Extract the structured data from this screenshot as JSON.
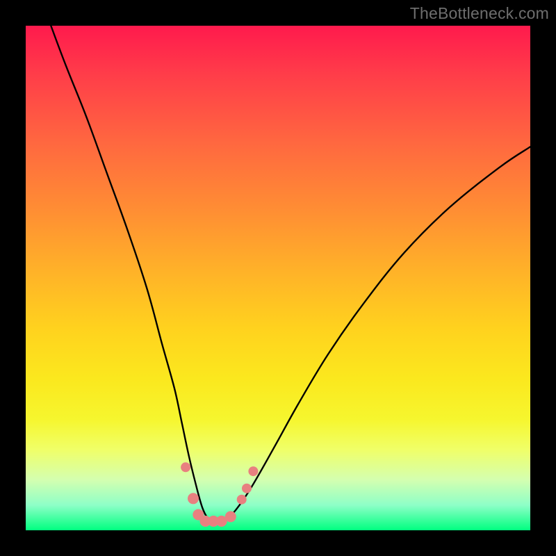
{
  "watermark": "TheBottleneck.com",
  "chart_data": {
    "type": "line",
    "title": "",
    "xlabel": "",
    "ylabel": "",
    "ylim": [
      0,
      100
    ],
    "xlim": [
      0,
      100
    ],
    "background": "rainbow-gradient",
    "series": [
      {
        "name": "bottleneck-curve",
        "x": [
          5,
          8,
          12,
          16,
          20,
          24,
          27,
          29.5,
          31,
          32.5,
          34,
          35,
          36,
          37,
          38.5,
          40,
          42,
          45,
          49,
          54,
          60,
          67,
          75,
          84,
          94,
          100
        ],
        "y": [
          100,
          92,
          82,
          71,
          60,
          48,
          37,
          28,
          21,
          14,
          8,
          4.5,
          2.5,
          1.8,
          1.8,
          2.4,
          4.5,
          9,
          16,
          25,
          35,
          45,
          55,
          64,
          72,
          76
        ]
      }
    ],
    "markers": {
      "name": "highlight-points",
      "color": "#e88080",
      "points": [
        {
          "x": 31.7,
          "y": 12.5,
          "r": 7
        },
        {
          "x": 33.2,
          "y": 6.3,
          "r": 8
        },
        {
          "x": 34.2,
          "y": 3.1,
          "r": 8
        },
        {
          "x": 35.6,
          "y": 1.8,
          "r": 8
        },
        {
          "x": 37.2,
          "y": 1.8,
          "r": 8
        },
        {
          "x": 38.8,
          "y": 1.8,
          "r": 8
        },
        {
          "x": 40.6,
          "y": 2.7,
          "r": 8
        },
        {
          "x": 42.8,
          "y": 6.1,
          "r": 7
        },
        {
          "x": 43.8,
          "y": 8.3,
          "r": 7
        },
        {
          "x": 45.1,
          "y": 11.7,
          "r": 7
        }
      ]
    }
  }
}
